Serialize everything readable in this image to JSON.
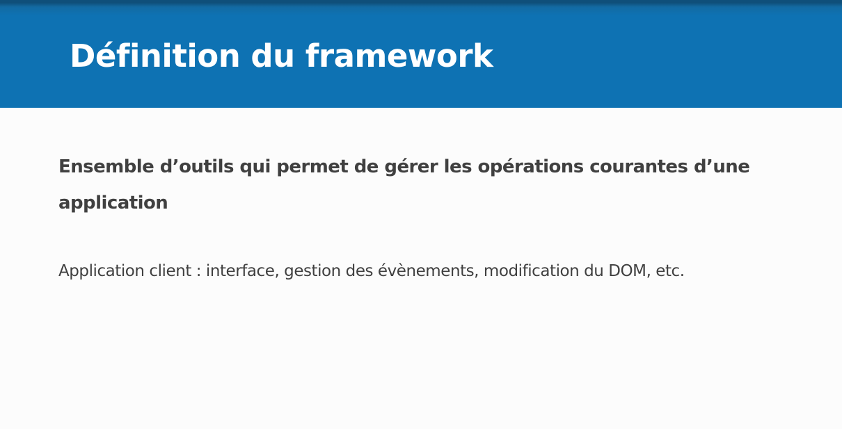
{
  "slide": {
    "title": "Définition du framework",
    "lead": "Ensemble d’outils qui permet de gérer les opérations courantes d’une application",
    "detail": "Application client : interface, gestion des évènements, modification du DOM, etc."
  },
  "colors": {
    "header_background": "#0e72b3",
    "title_text": "#ffffff",
    "body_text": "#404040",
    "page_background": "#fcfcfc"
  }
}
